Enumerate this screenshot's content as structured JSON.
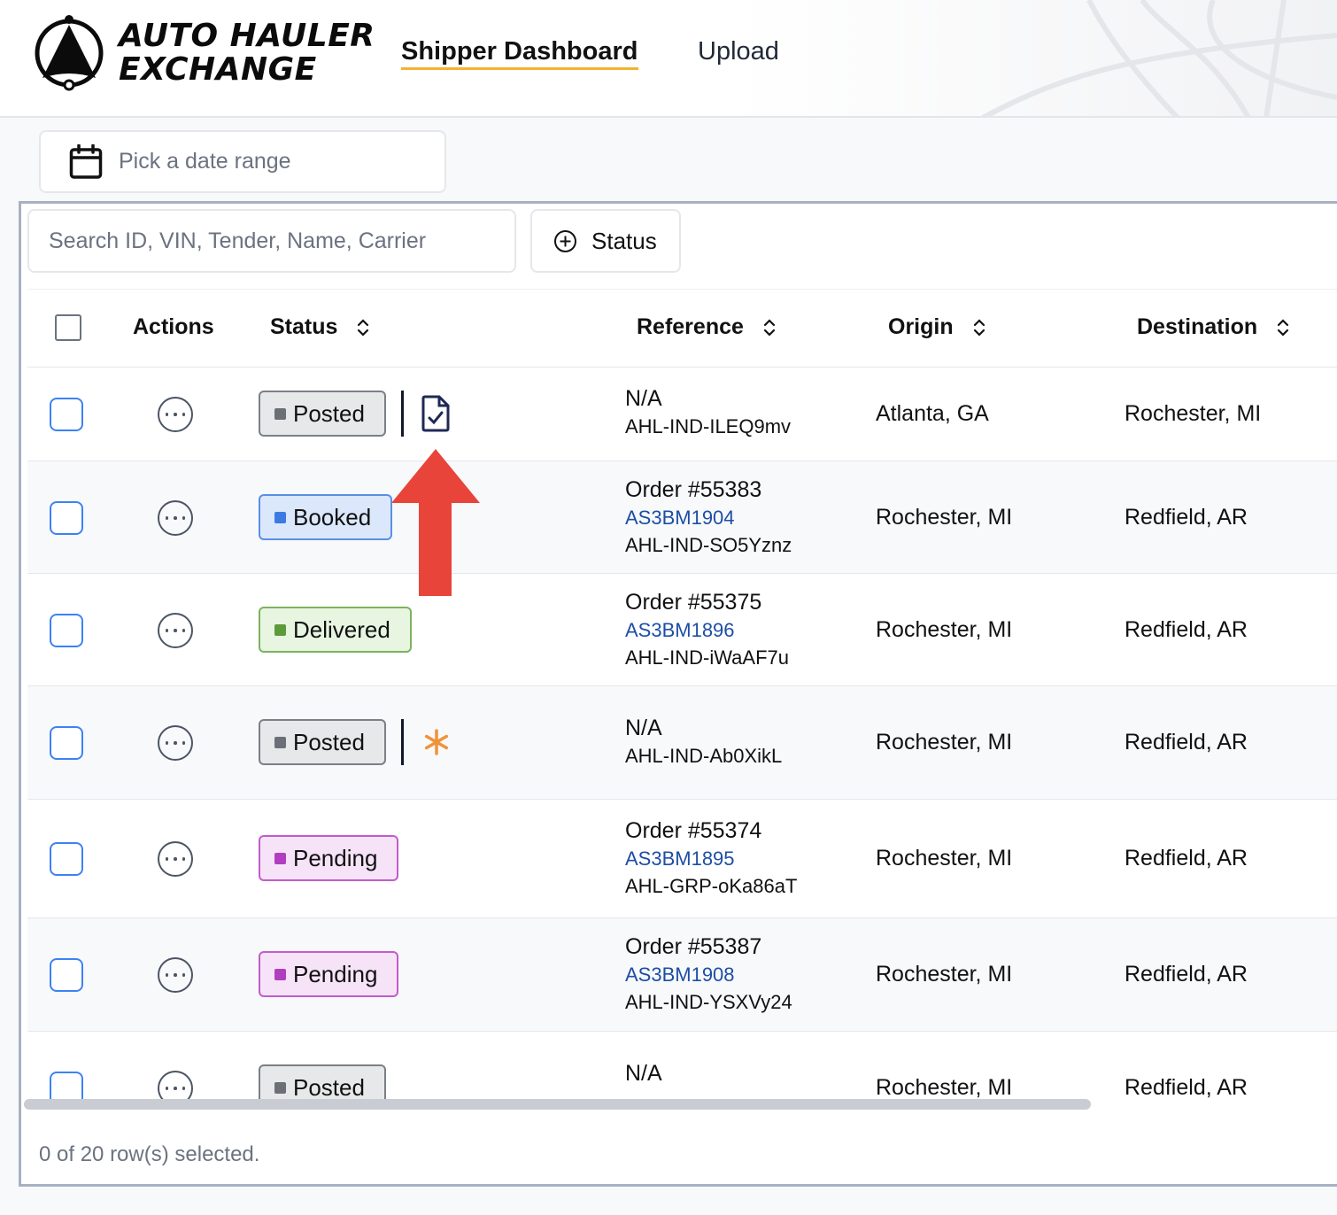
{
  "header": {
    "brand_line1": "AUTO HAULER",
    "brand_line2": "EXCHANGE",
    "nav": [
      {
        "label": "Shipper Dashboard",
        "active": true
      },
      {
        "label": "Upload",
        "active": false
      }
    ],
    "accent": "#f2b233"
  },
  "date_range": {
    "placeholder": "Pick a date range",
    "icon": "calendar-icon"
  },
  "toolbar": {
    "search_placeholder": "Search ID, VIN, Tender, Name, Carrier",
    "status_filter_label": "Status",
    "status_filter_icon": "plus-circle-icon"
  },
  "table": {
    "columns": [
      "Actions",
      "Status",
      "Reference",
      "Origin",
      "Destination"
    ],
    "rows": [
      {
        "status": "Posted",
        "ref_main": "N/A",
        "ref_link": "",
        "ref_id": "AHL-IND-ILEQ9mv",
        "origin": "Atlanta, GA",
        "destination": "Rochester, MI",
        "extra_icon": "document-check-icon"
      },
      {
        "status": "Booked",
        "ref_main": "Order #55383",
        "ref_link": "AS3BM1904",
        "ref_id": "AHL-IND-SO5Yznz",
        "origin": "Rochester, MI",
        "destination": "Redfield, AR"
      },
      {
        "status": "Delivered",
        "ref_main": "Order #55375",
        "ref_link": "AS3BM1896",
        "ref_id": "AHL-IND-iWaAF7u",
        "origin": "Rochester, MI",
        "destination": "Redfield, AR"
      },
      {
        "status": "Posted",
        "ref_main": "N/A",
        "ref_link": "",
        "ref_id": "AHL-IND-Ab0XikL",
        "origin": "Rochester, MI",
        "destination": "Redfield, AR",
        "extra_icon": "asterisk-icon"
      },
      {
        "status": "Pending",
        "ref_main": "Order #55374",
        "ref_link": "AS3BM1895",
        "ref_id": "AHL-GRP-oKa86aT",
        "origin": "Rochester, MI",
        "destination": "Redfield, AR"
      },
      {
        "status": "Pending",
        "ref_main": "Order #55387",
        "ref_link": "AS3BM1908",
        "ref_id": "AHL-IND-YSXVy24",
        "origin": "Rochester, MI",
        "destination": "Redfield, AR"
      },
      {
        "status": "Posted",
        "ref_main": "N/A",
        "ref_link": "",
        "ref_id": "",
        "origin": "Rochester, MI",
        "destination": "Redfield, AR"
      }
    ]
  },
  "footer": {
    "selection_text": "0 of 20 row(s) selected."
  },
  "colors": {
    "posted": "#6b6f76",
    "booked": "#3b7ae0",
    "delivered": "#5d9b3a",
    "pending": "#b13ec0",
    "link": "#1d4ea5",
    "annotation_arrow": "#e8443a",
    "asterisk": "#f0923a"
  }
}
